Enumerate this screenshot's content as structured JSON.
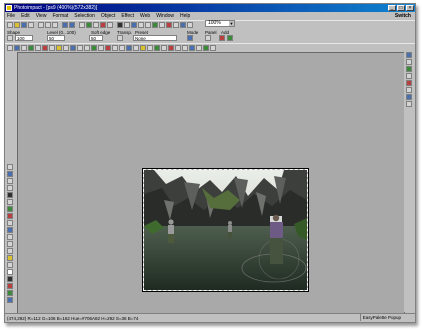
{
  "window": {
    "title": "Photoimpact - [ps9 (400%)(572x382)]"
  },
  "menubar": {
    "items": [
      "File",
      "Edit",
      "View",
      "Format",
      "Selection",
      "Object",
      "Effect",
      "Web",
      "Window",
      "Help"
    ],
    "right": "Switch"
  },
  "zoom": "100%",
  "options": {
    "labels": [
      "Shape",
      "Level (0...100)",
      "Soft edge",
      "Transp.",
      "Preset",
      "Mode",
      "Panel",
      "Add"
    ],
    "shape_value": "100",
    "level_value": "50",
    "soft_value": "50",
    "transp_value": "0",
    "preset_value": "None"
  },
  "status": {
    "text": "(474,292) R=112 G=106 B=162  Hue=#706A82  H=292 S=36 B=74",
    "right": "EasyPalette Popup"
  },
  "colors": {
    "title_start": "#000080",
    "title_end": "#1084d0",
    "workspace": "#a9a9a9"
  }
}
